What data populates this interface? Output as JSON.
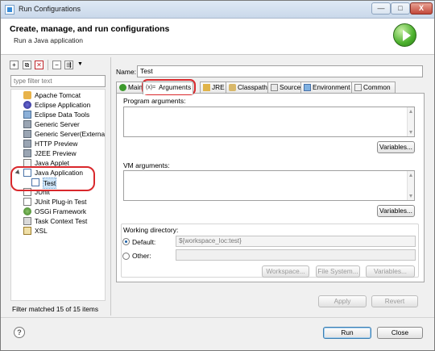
{
  "window": {
    "title": "Run Configurations",
    "min": "—",
    "max": "□",
    "close": "X"
  },
  "banner": {
    "title": "Create, manage, and run configurations",
    "subtitle": "Run a Java application"
  },
  "filter": {
    "placeholder": "type filter text"
  },
  "tree": {
    "items": [
      {
        "label": "Apache Tomcat",
        "icon": "tomcat-icon"
      },
      {
        "label": "Eclipse Application",
        "icon": "eclipse-icon"
      },
      {
        "label": "Eclipse Data Tools",
        "icon": "data-tools-icon"
      },
      {
        "label": "Generic Server",
        "icon": "server-icon"
      },
      {
        "label": "Generic Server(External L",
        "icon": "server-icon"
      },
      {
        "label": "HTTP Preview",
        "icon": "server-icon"
      },
      {
        "label": "J2EE Preview",
        "icon": "server-icon"
      },
      {
        "label": "Java Applet",
        "icon": "applet-icon"
      },
      {
        "label": "Java Application",
        "icon": "java-app-icon"
      },
      {
        "label": "Test",
        "icon": "java-config-icon"
      },
      {
        "label": "JUnit",
        "icon": "junit-icon"
      },
      {
        "label": "JUnit Plug-in Test",
        "icon": "junit-plugin-icon"
      },
      {
        "label": "OSGi Framework",
        "icon": "osgi-icon"
      },
      {
        "label": "Task Context Test",
        "icon": "task-icon"
      },
      {
        "label": "XSL",
        "icon": "xsl-icon"
      }
    ],
    "status": "Filter matched 15 of 15 items"
  },
  "config": {
    "name_label": "Name:",
    "name_value": "Test",
    "tabs": [
      {
        "label": "Main",
        "icon": "main-tab-icon"
      },
      {
        "label": "Arguments",
        "icon": "arguments-tab-icon"
      },
      {
        "label": "JRE",
        "icon": "jre-tab-icon"
      },
      {
        "label": "Classpath",
        "icon": "classpath-tab-icon"
      },
      {
        "label": "Source",
        "icon": "source-tab-icon"
      },
      {
        "label": "Environment",
        "icon": "environment-tab-icon"
      },
      {
        "label": "Common",
        "icon": "common-tab-icon"
      }
    ],
    "active_tab": "Arguments",
    "program_args_label": "Program arguments:",
    "program_args_value": "",
    "variables_label": "Variables...",
    "vm_args_label": "VM arguments:",
    "vm_args_value": "",
    "working_dir_label": "Working directory:",
    "default_label": "Default:",
    "default_value": "${workspace_loc:test}",
    "other_label": "Other:",
    "other_value": "",
    "workspace_btn": "Workspace...",
    "filesystem_btn": "File System...",
    "variables_btn": "Variables...",
    "apply_btn": "Apply",
    "revert_btn": "Revert"
  },
  "footer": {
    "help": "?",
    "run": "Run",
    "close": "Close"
  },
  "colors": {
    "annotation": "#d9282c",
    "selection": "#cde4f7",
    "run_icon": "#4bb02c"
  }
}
